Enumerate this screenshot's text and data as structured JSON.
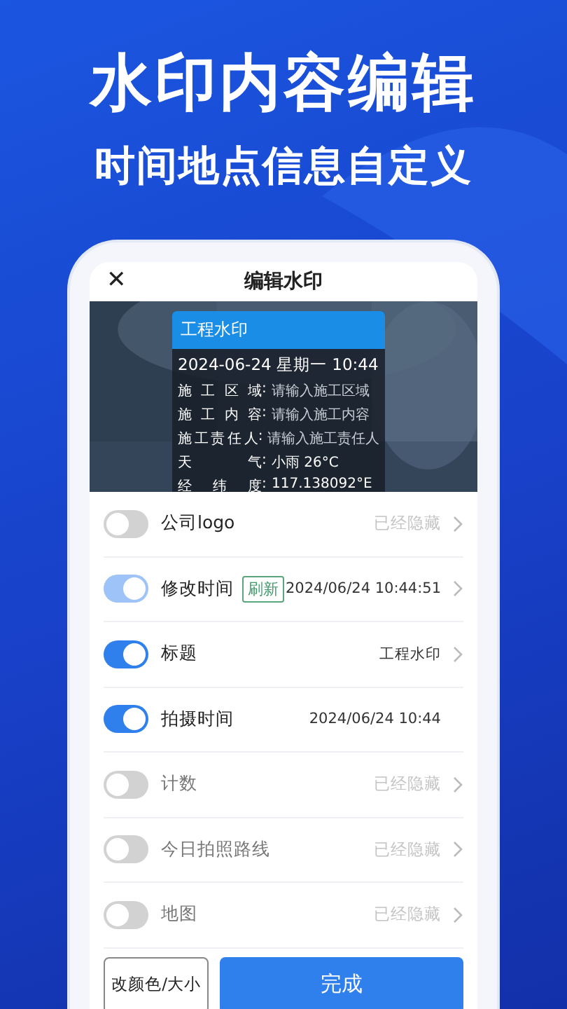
{
  "headline": "水印内容编辑",
  "subheadline": "时间地点信息自定义",
  "dialog": {
    "close": "✕",
    "title": "编辑水印"
  },
  "watermark": {
    "title": "工程水印",
    "datetime": "2024-06-24 星期一 10:44",
    "lines": [
      {
        "label": "施工区域",
        "sep": ":",
        "value": "请输入施工区域",
        "placeholder": true
      },
      {
        "label": "施工内容",
        "sep": ":",
        "value": "请输入施工内容",
        "placeholder": true
      },
      {
        "label": "施工责任人",
        "sep": ":",
        "value": "请输入施工责任人",
        "placeholder": true
      },
      {
        "label": "天气",
        "sep": ":",
        "value": "小雨 26°C",
        "placeholder": false
      },
      {
        "label": "经纬度",
        "sep": ":",
        "value": "117.138092°E",
        "placeholder": false
      }
    ]
  },
  "rows": [
    {
      "label": "公司logo",
      "on": false,
      "faded": false,
      "disabled": false,
      "value": "已经隐藏",
      "value_muted": true,
      "chevron": true
    },
    {
      "label": "修改时间",
      "on": true,
      "faded": true,
      "disabled": false,
      "badge": "刷新",
      "value": "2024/06/24 10:44:51",
      "value_muted": false,
      "chevron": true
    },
    {
      "label": "标题",
      "on": true,
      "faded": false,
      "disabled": false,
      "value": "工程水印",
      "value_muted": false,
      "chevron": true
    },
    {
      "label": "拍摄时间",
      "on": true,
      "faded": false,
      "disabled": false,
      "value": "2024/06/24 10:44",
      "value_muted": false,
      "chevron": false
    },
    {
      "label": "计数",
      "on": false,
      "faded": false,
      "disabled": true,
      "value": "已经隐藏",
      "value_muted": true,
      "chevron": true
    },
    {
      "label": "今日拍照路线",
      "on": false,
      "faded": false,
      "disabled": true,
      "value": "已经隐藏",
      "value_muted": true,
      "chevron": true
    },
    {
      "label": "地图",
      "on": false,
      "faded": false,
      "disabled": true,
      "value": "已经隐藏",
      "value_muted": true,
      "chevron": true
    }
  ],
  "buttons": {
    "secondary": "改颜色/大小",
    "primary": "完成"
  }
}
